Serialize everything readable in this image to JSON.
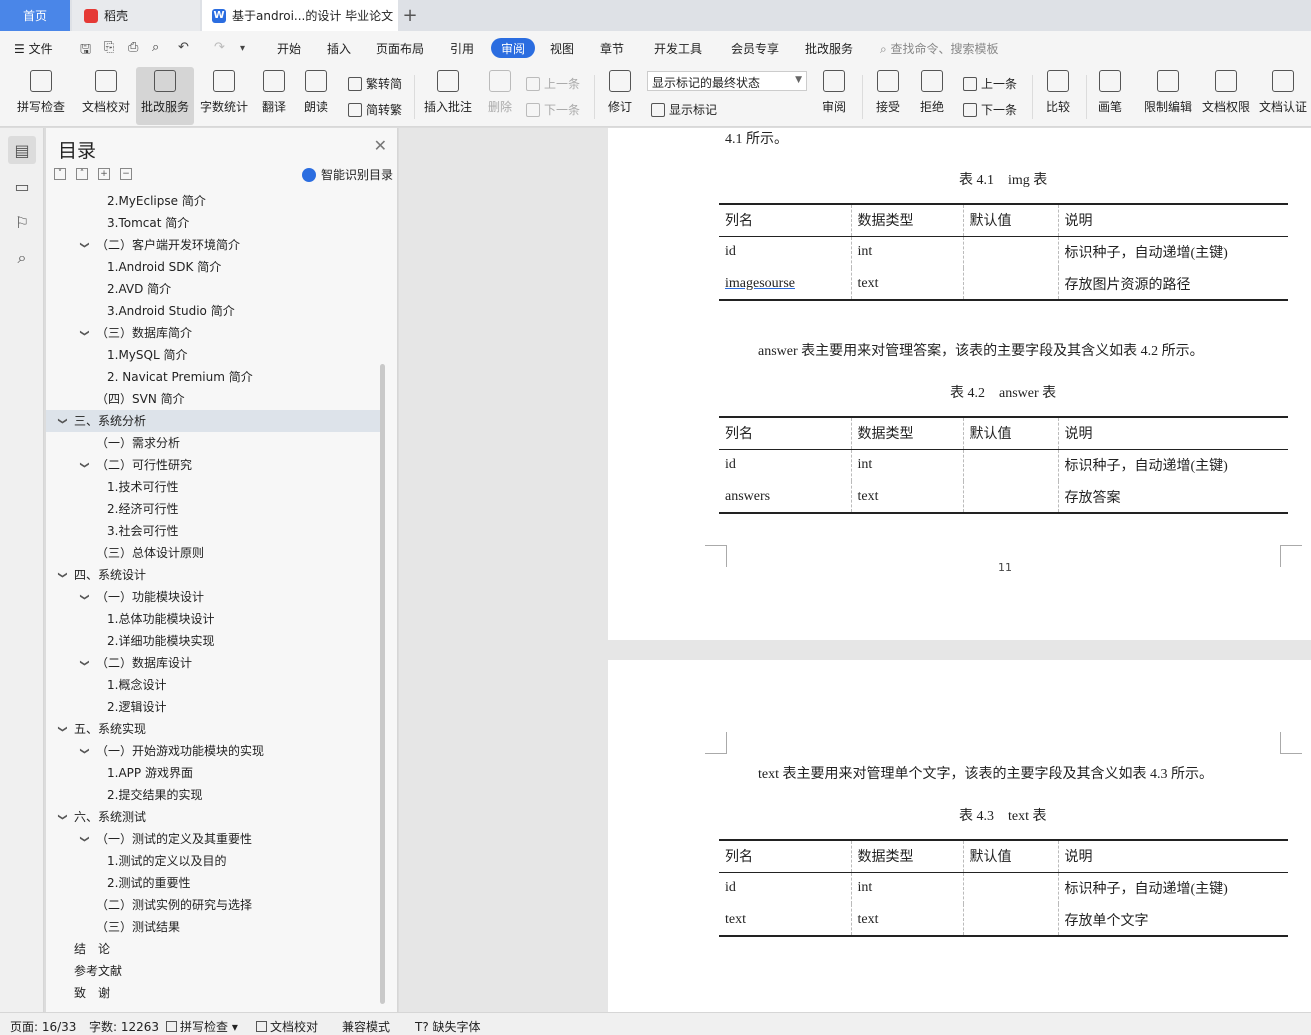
{
  "tabs": {
    "home": "首页",
    "daoke": "稻壳",
    "doc": "基于androi...的设计 毕业论文"
  },
  "menu": {
    "file": "文件",
    "items": [
      "开始",
      "插入",
      "页面布局",
      "引用",
      "审阅",
      "视图",
      "章节",
      "开发工具",
      "会员专享",
      "批改服务"
    ],
    "active_index": 4,
    "search_placeholder": "查找命令、搜索模板"
  },
  "ribbon": {
    "spell": "拼写检查",
    "doc_check": "文档校对",
    "correct_service": "批改服务",
    "word_count": "字数统计",
    "translate": "翻译",
    "read_aloud": "朗读",
    "trad_to_simp": "繁转简",
    "simp_to_trad": "简转繁",
    "insert_comment": "插入批注",
    "delete": "删除",
    "prev": "上一条",
    "next": "下一条",
    "revise": "修订",
    "markup_state": "显示标记的最终状态",
    "show_markup": "显示标记",
    "review": "审阅",
    "accept": "接受",
    "reject": "拒绝",
    "prev2": "上一条",
    "next2": "下一条",
    "compare": "比较",
    "pen": "画笔",
    "restrict_edit": "限制编辑",
    "doc_rights": "文档权限",
    "doc_auth": "文档认证"
  },
  "toc": {
    "title": "目录",
    "smart": "智能识别目录",
    "items": [
      {
        "text": "2.MyEclipse 简介",
        "level": 3
      },
      {
        "text": "3.Tomcat 简介",
        "level": 3
      },
      {
        "text": "（二）客户端开发环境简介",
        "level": 2,
        "expandable": true
      },
      {
        "text": "1.Android SDK 简介",
        "level": 3
      },
      {
        "text": "2.AVD 简介",
        "level": 3
      },
      {
        "text": "3.Android Studio 简介",
        "level": 3
      },
      {
        "text": "（三）数据库简介",
        "level": 2,
        "expandable": true
      },
      {
        "text": "1.MySQL 简介",
        "level": 3
      },
      {
        "text": "2. Navicat Premium 简介",
        "level": 3
      },
      {
        "text": "（四）SVN 简介",
        "level": 2
      },
      {
        "text": "三、系统分析",
        "level": 1,
        "expandable": true,
        "selected": true
      },
      {
        "text": "（一）需求分析",
        "level": 2
      },
      {
        "text": "（二）可行性研究",
        "level": 2,
        "expandable": true
      },
      {
        "text": "1.技术可行性",
        "level": 3
      },
      {
        "text": "2.经济可行性",
        "level": 3
      },
      {
        "text": "3.社会可行性",
        "level": 3
      },
      {
        "text": "（三）总体设计原则",
        "level": 2
      },
      {
        "text": "四、系统设计",
        "level": 1,
        "expandable": true
      },
      {
        "text": "（一）功能模块设计",
        "level": 2,
        "expandable": true
      },
      {
        "text": "1.总体功能模块设计",
        "level": 3
      },
      {
        "text": "2.详细功能模块实现",
        "level": 3
      },
      {
        "text": "（二）数据库设计",
        "level": 2,
        "expandable": true
      },
      {
        "text": "1.概念设计",
        "level": 3
      },
      {
        "text": "2.逻辑设计",
        "level": 3
      },
      {
        "text": "五、系统实现",
        "level": 1,
        "expandable": true
      },
      {
        "text": "（一）开始游戏功能模块的实现",
        "level": 2,
        "expandable": true
      },
      {
        "text": "1.APP 游戏界面",
        "level": 3
      },
      {
        "text": "2.提交结果的实现",
        "level": 3
      },
      {
        "text": "六、系统测试",
        "level": 1,
        "expandable": true
      },
      {
        "text": "（一）测试的定义及其重要性",
        "level": 2,
        "expandable": true
      },
      {
        "text": "1.测试的定义以及目的",
        "level": 3
      },
      {
        "text": "2.测试的重要性",
        "level": 3
      },
      {
        "text": "（二）测试实例的研究与选择",
        "level": 2
      },
      {
        "text": "（三）测试结果",
        "level": 2
      },
      {
        "text": "结　论",
        "level": 1
      },
      {
        "text": "参考文献",
        "level": 1
      },
      {
        "text": "致　谢",
        "level": 1
      }
    ]
  },
  "doc": {
    "top_text": "4.1 所示。",
    "table1_caption": "表 4.1　img 表",
    "headers": [
      "列名",
      "数据类型",
      "默认值",
      "说明"
    ],
    "table1_rows": [
      [
        "id",
        "int",
        "",
        "标识种子，自动递增(主键)"
      ],
      [
        "imagesourse",
        "text",
        "",
        "存放图片资源的路径"
      ]
    ],
    "para_answer": "answer 表主要用来对管理答案，该表的主要字段及其含义如表 4.2 所示。",
    "table2_caption": "表 4.2　answer 表",
    "table2_rows": [
      [
        "id",
        "int",
        "",
        "标识种子，自动递增(主键)"
      ],
      [
        "answers",
        "text",
        "",
        "存放答案"
      ]
    ],
    "page_number": "11",
    "para_text": "text 表主要用来对管理单个文字，该表的主要字段及其含义如表 4.3 所示。",
    "table3_caption": "表 4.3　text 表",
    "table3_rows": [
      [
        "id",
        "int",
        "",
        "标识种子，自动递增(主键)"
      ],
      [
        "text",
        "text",
        "",
        "存放单个文字"
      ]
    ]
  },
  "status": {
    "page": "页面: 16/33",
    "words": "字数: 12263",
    "spell": "拼写检查",
    "doc_check": "文档校对",
    "compat": "兼容模式",
    "missing_font": "缺失字体"
  }
}
